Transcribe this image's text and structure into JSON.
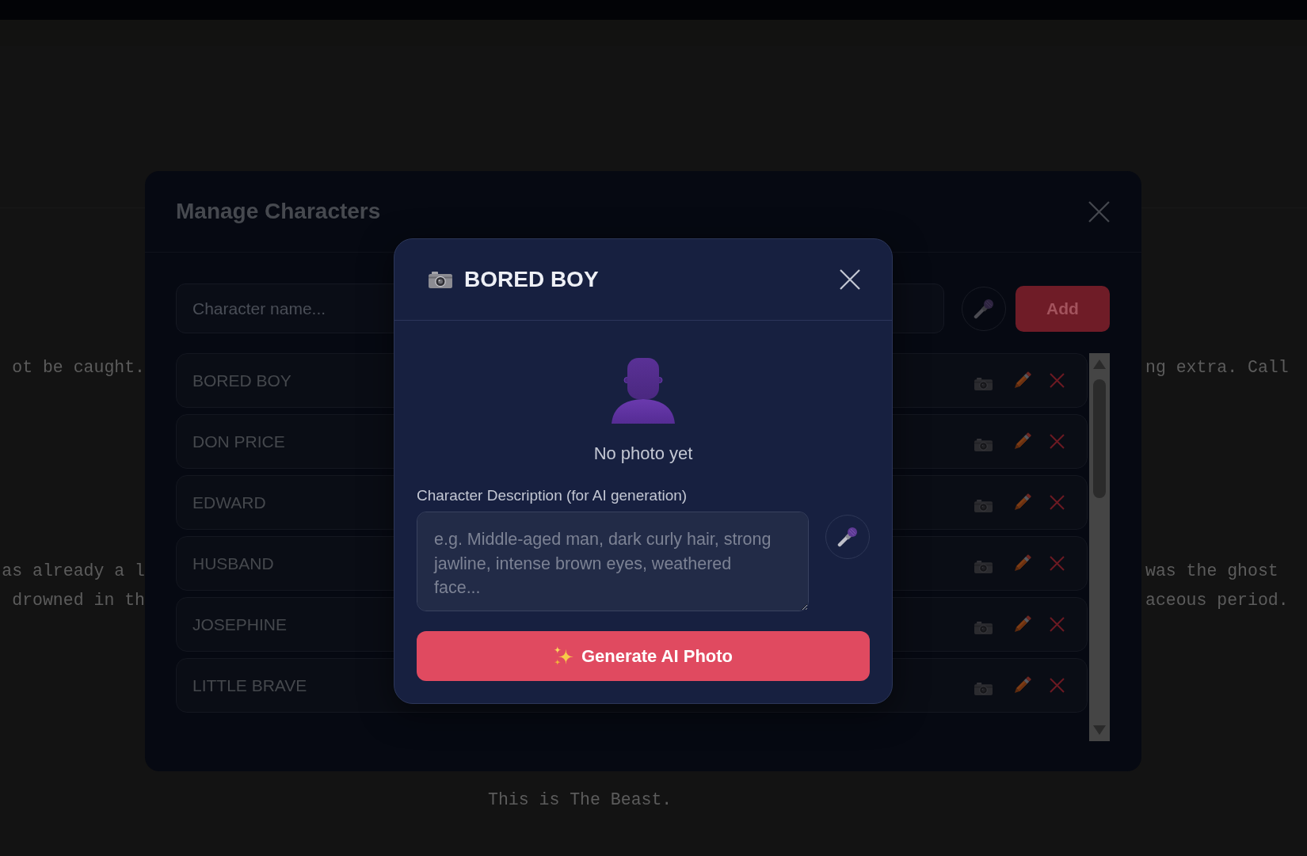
{
  "background_script": [
    {
      "kind": "split",
      "left": "ot be caught.",
      "right": "ng extra. Call"
    },
    {
      "kind": "split",
      "left": "as already a l",
      "right": "was the ghost"
    },
    {
      "kind": "split",
      "left": "drowned in th",
      "right": "aceous period."
    },
    {
      "kind": "centered",
      "text": "This is The Beast."
    }
  ],
  "manage_characters": {
    "title": "Manage Characters",
    "name_field": {
      "placeholder": "Character name..."
    },
    "add_button": "Add",
    "characters": [
      {
        "name": "BORED BOY"
      },
      {
        "name": "DON PRICE"
      },
      {
        "name": "EDWARD"
      },
      {
        "name": "HUSBAND"
      },
      {
        "name": "JOSEPHINE"
      },
      {
        "name": "LITTLE BRAVE"
      }
    ]
  },
  "photo_dialog": {
    "title": "BORED BOY",
    "photo_status": "No photo yet",
    "description_label": "Character Description (for AI generation)",
    "description_field": {
      "placeholder": "e.g. Middle-aged man, dark curly hair, strong jawline, intense brown eyes, weathered face..."
    },
    "generate_button": "Generate AI Photo"
  }
}
